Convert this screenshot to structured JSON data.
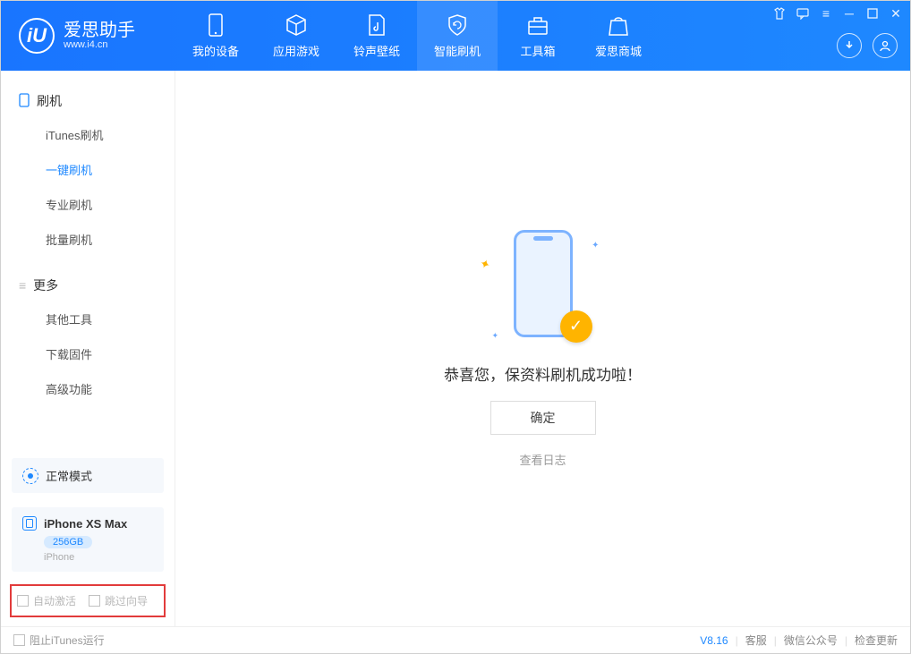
{
  "header": {
    "app_name": "爱思助手",
    "app_url": "www.i4.cn",
    "tabs": [
      {
        "label": "我的设备"
      },
      {
        "label": "应用游戏"
      },
      {
        "label": "铃声壁纸"
      },
      {
        "label": "智能刷机"
      },
      {
        "label": "工具箱"
      },
      {
        "label": "爱思商城"
      }
    ]
  },
  "sidebar": {
    "group1": {
      "title": "刷机",
      "items": [
        "iTunes刷机",
        "一键刷机",
        "专业刷机",
        "批量刷机"
      ]
    },
    "group2": {
      "title": "更多",
      "items": [
        "其他工具",
        "下载固件",
        "高级功能"
      ]
    },
    "mode_label": "正常模式",
    "device": {
      "name": "iPhone XS Max",
      "storage": "256GB",
      "type": "iPhone"
    },
    "opt_auto_activate": "自动激活",
    "opt_skip_guide": "跳过向导"
  },
  "main": {
    "success_text": "恭喜您，保资料刷机成功啦！",
    "ok_button": "确定",
    "view_log": "查看日志"
  },
  "footer": {
    "block_itunes": "阻止iTunes运行",
    "version": "V8.16",
    "support": "客服",
    "wechat": "微信公众号",
    "check_update": "检查更新"
  }
}
